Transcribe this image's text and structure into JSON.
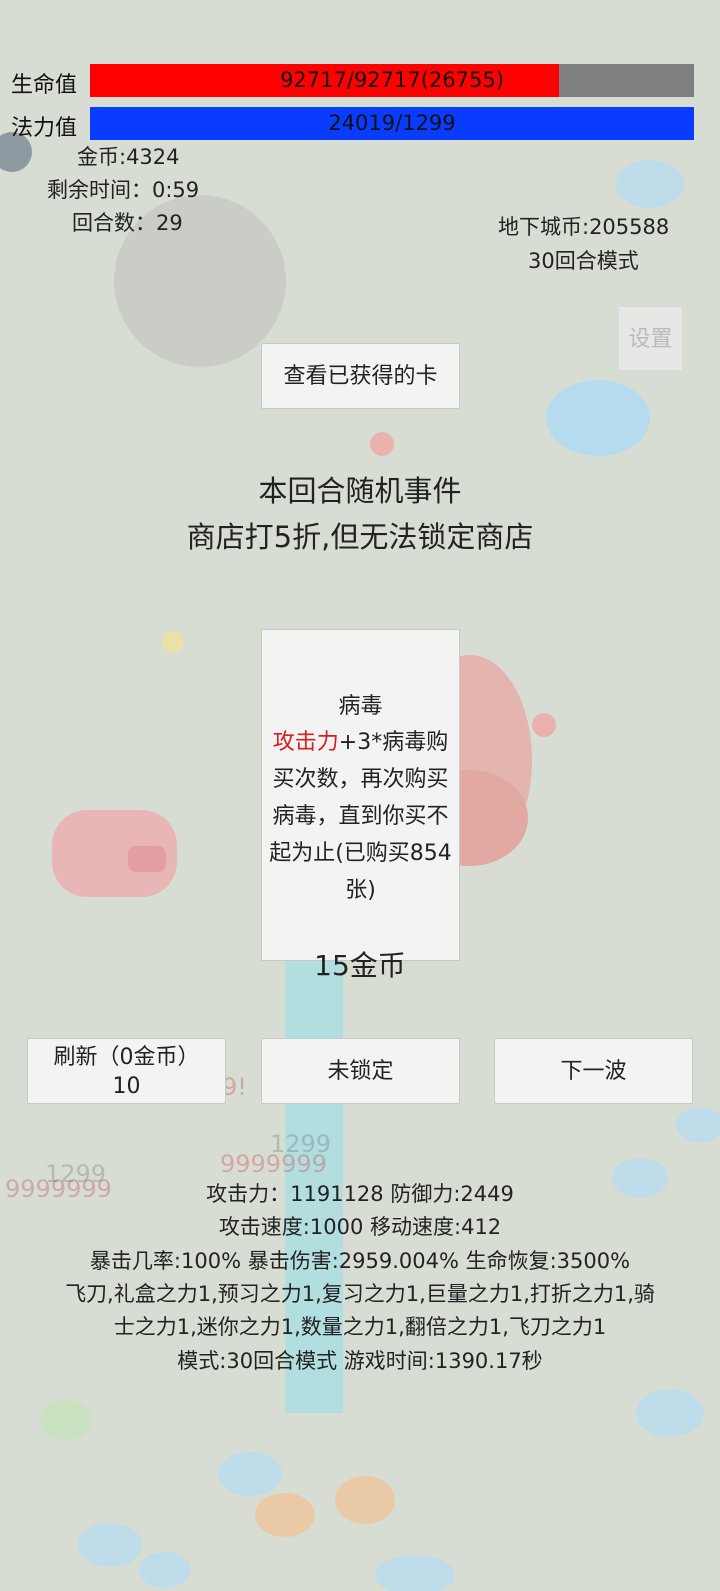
{
  "hud": {
    "hp_label": "生命值",
    "hp_text": "92717/92717(26755)",
    "hp_ratio": 0.776,
    "hp_color": "#ff0000",
    "mp_label": "法力值",
    "mp_text": "24019/1299",
    "mp_ratio": 1.0,
    "mp_color": "#0a3cff",
    "gold": "金币:4324",
    "time_left": "剩余时间：0:59",
    "round": "回合数：29",
    "dungeon_coins": "地下城币:205588",
    "mode": "30回合模式",
    "settings_label": "设置"
  },
  "buttons": {
    "view_cards": "查看已获得的卡",
    "refresh_line1": "刷新（0金币）",
    "refresh_line2": "10",
    "lock": "未锁定",
    "next_wave": "下一波"
  },
  "event": {
    "title": "本回合随机事件",
    "desc": "商店打5折,但无法锁定商店"
  },
  "card": {
    "name": "病毒",
    "keyword": "攻击力",
    "desc_rest": "+3*病毒购买次数，再次购买病毒，直到你买不起为止(已购买854张)",
    "price": "15金币",
    "keyword_color": "#d42020"
  },
  "stats": {
    "line1": "攻击力：1191128 防御力:2449",
    "line2": "攻击速度:1000 移动速度:412",
    "line3": "暴击几率:100% 暴击伤害:2959.004% 生命恢复:3500%",
    "line4": "飞刀,礼盒之力1,预习之力1,复习之力1,巨量之力1,打折之力1,骑",
    "line5": "士之力1,迷你之力1,数量之力1,翻倍之力1,飞刀之力1",
    "line6": "模式:30回合模式 游戏时间:1390.17秒"
  },
  "background_numbers": [
    "1299",
    "9999999",
    "9999999",
    "1299",
    "9!"
  ]
}
